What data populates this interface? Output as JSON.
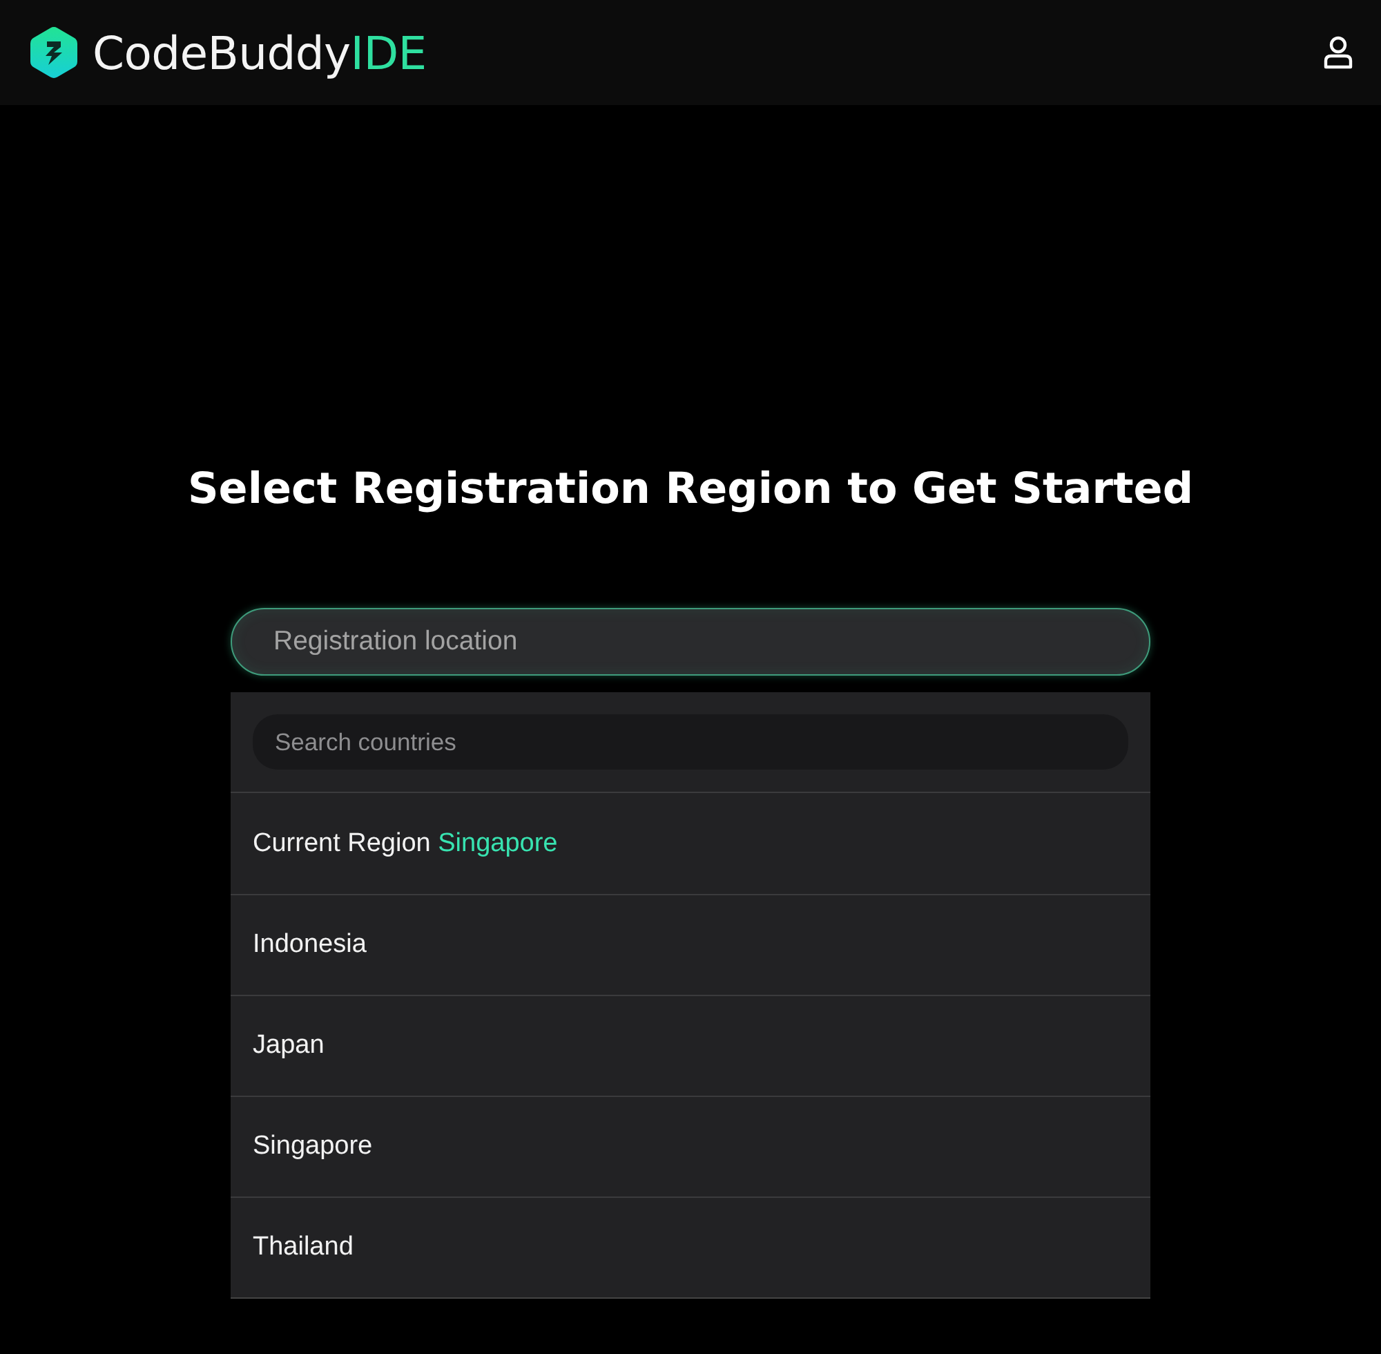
{
  "header": {
    "brand": {
      "name": "CodeBuddy",
      "suffix": "IDE"
    }
  },
  "heading": "Select Registration Region to Get Started",
  "location_field": {
    "placeholder": "Registration location"
  },
  "dropdown": {
    "search": {
      "placeholder": "Search countries"
    },
    "current_region": {
      "label": "Current Region",
      "value": "Singapore"
    },
    "regions": [
      "Indonesia",
      "Japan",
      "Singapore",
      "Thailand"
    ]
  }
}
